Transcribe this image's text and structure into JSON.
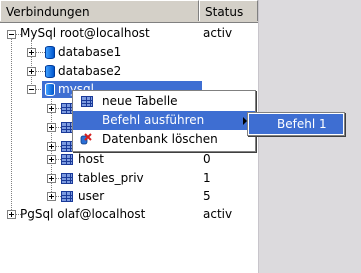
{
  "header": {
    "name_col": "Verbindungen",
    "status_col": "Status"
  },
  "tree": {
    "mysql_conn": {
      "label": "MySql root@localhost",
      "status": "activ"
    },
    "db1": {
      "label": "database1"
    },
    "db2": {
      "label": "database2"
    },
    "mysql_db": {
      "label": "mysql"
    },
    "tables": [
      {
        "label": "host",
        "status": "0"
      },
      {
        "label": "tables_priv",
        "status": "1"
      },
      {
        "label": "user",
        "status": "5"
      }
    ],
    "pgsql_conn": {
      "label": "PgSql olaf@localhost",
      "status": "activ"
    }
  },
  "context_menu": {
    "items": [
      {
        "label": "neue Tabelle",
        "icon": "table-icon"
      },
      {
        "label": "Befehl ausführen",
        "icon": "",
        "has_submenu": true,
        "active": true
      },
      {
        "label": "Datenbank löschen",
        "icon": "delete-icon"
      }
    ]
  },
  "submenu": {
    "items": [
      {
        "label": "Befehl 1",
        "active": true
      }
    ]
  },
  "colors": {
    "selection": "#3e6ed2",
    "background": "#d4d0c8"
  }
}
